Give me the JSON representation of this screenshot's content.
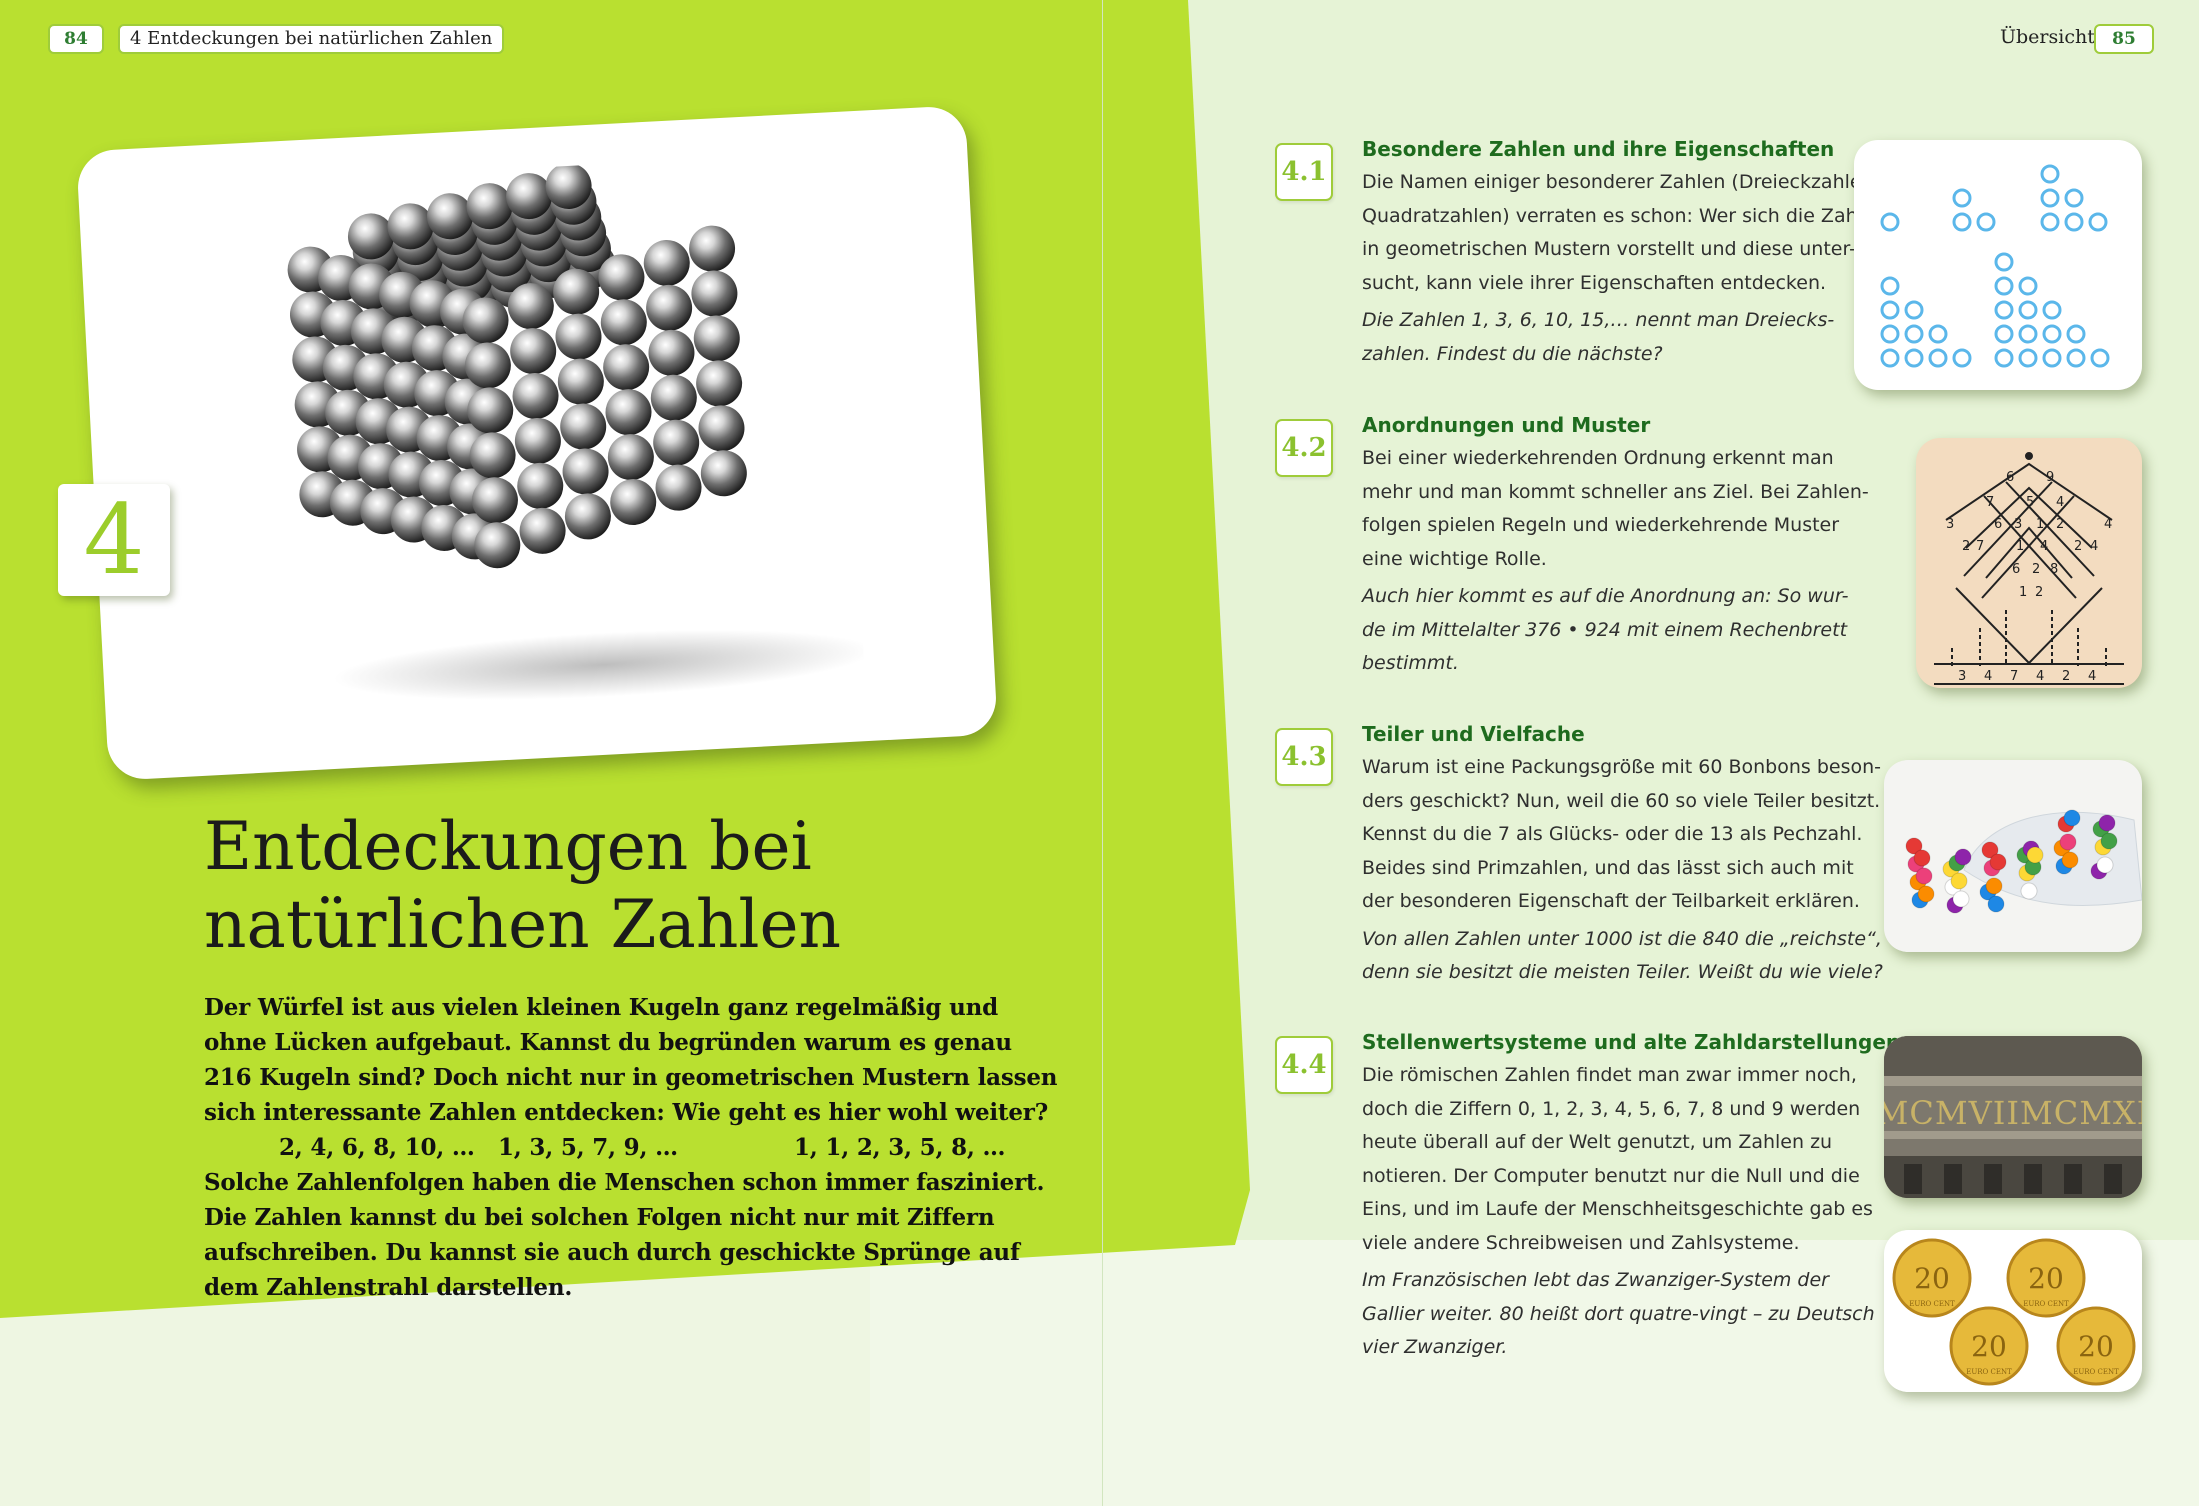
{
  "left_page": {
    "page_number": "84",
    "running_head": "4  Entdeckungen bei natürlichen Zahlen",
    "chapter_number": "4",
    "title_lines": [
      "Entdeckungen bei",
      "natürlichen Zahlen"
    ],
    "intro_lines": [
      "Der Würfel ist aus vielen kleinen Kugeln ganz regelmäßig und",
      "ohne Lücken aufgebaut. Kannst du begründen warum es genau",
      "216 Kugeln sind? Doch nicht nur in geometrischen Mustern lassen",
      "sich interessante Zahlen entdecken: Wie geht es hier wohl weiter?"
    ],
    "sequences": [
      "2, 4, 6, 8, 10, …",
      "1, 3, 5, 7, 9, …",
      "1, 1, 2, 3, 5, 8, …"
    ],
    "outro_lines": [
      "Solche Zahlenfolgen haben die Menschen schon immer fasziniert.",
      "Die Zahlen kannst du bei solchen Folgen nicht nur mit Ziffern",
      "aufschreiben. Du kannst sie auch durch geschickte Sprünge auf",
      "dem Zahlenstrahl darstellen."
    ]
  },
  "right_page": {
    "overview_label": "Übersicht",
    "page_number": "85",
    "sections": [
      {
        "number": "4.1",
        "title": "Besondere Zahlen und ihre Eigenschaften",
        "body": [
          "Die Namen einiger besonderer Zahlen (Dreieckzahlen,",
          "Quadratzahlen) verraten es schon: Wer sich die Zahlen",
          "in geometrischen Mustern vorstellt und diese unter-",
          "sucht, kann viele ihrer Eigenschaften entdecken."
        ],
        "italic": [
          "Die Zahlen 1, 3, 6, 10, 15,… nennt man Dreiecks-",
          "zahlen. Findest du die nächste?"
        ]
      },
      {
        "number": "4.2",
        "title": "Anordnungen und Muster",
        "body": [
          "Bei einer wiederkehrenden Ordnung erkennt man",
          "mehr und man kommt schneller ans Ziel. Bei Zahlen-",
          "folgen spielen Regeln und wiederkehrende Muster",
          "eine wichtige Rolle."
        ],
        "italic": [
          "Auch hier kommt es auf die Anordnung an: So wur-",
          "de im Mittelalter 376 • 924 mit einem Rechenbrett",
          "bestimmt."
        ]
      },
      {
        "number": "4.3",
        "title": "Teiler und Vielfache",
        "body": [
          "Warum ist eine Packungsgröße mit 60 Bonbons beson-",
          "ders geschickt? Nun, weil die 60 so viele Teiler besitzt.",
          "Kennst du die 7 als Glücks- oder die 13 als Pechzahl.",
          "Beides sind Primzahlen, und das lässt sich auch mit",
          "der besonderen Eigenschaft der Teilbarkeit erklären."
        ],
        "italic": [
          "Von allen Zahlen unter 1000 ist die 840 die „reichste“,",
          "denn sie besitzt die meisten Teiler. Weißt du wie viele?"
        ]
      },
      {
        "number": "4.4",
        "title": "Stellenwertsysteme und alte Zahldarstellungen",
        "body": [
          "Die römischen Zahlen findet man zwar immer noch,",
          "doch die Ziffern 0, 1, 2, 3, 4, 5, 6, 7, 8 und 9 werden",
          "heute überall auf der Welt genutzt, um Zahlen zu",
          "notieren. Der Computer benutzt nur die Null und die",
          "Eins, und im Laufe der Menschheitsgeschichte gab es",
          "viele andere Schreibweisen und Zahlsysteme."
        ],
        "italic": [
          "Im Französischen lebt das Zwanziger-System der",
          "Gallier weiter. 80 heißt dort quatre-vingt  – zu Deutsch",
          "vier Zwanziger."
        ]
      }
    ],
    "lattice_digits": {
      "top": [
        "6",
        "9"
      ],
      "upper": [
        "7",
        "5",
        "4"
      ],
      "middle": [
        "3",
        "6",
        "3",
        "1",
        "2",
        "4"
      ],
      "lower": [
        "2",
        "7",
        "1",
        "4",
        "2",
        "4"
      ],
      "bottom": [
        "6",
        "2",
        "8"
      ],
      "base": [
        "1",
        "2"
      ],
      "result": [
        "3",
        "4",
        "7",
        "4",
        "2",
        "4"
      ]
    },
    "roman_inscription": "MCMVIIMCMXI",
    "coin_value": "20",
    "coin_label": "EURO CENT"
  },
  "colors": {
    "green_block": "#b9e030",
    "accent_green": "#9fcc3a",
    "heading_green": "#1e6b1e",
    "dot_blue": "#5bb7ea"
  }
}
